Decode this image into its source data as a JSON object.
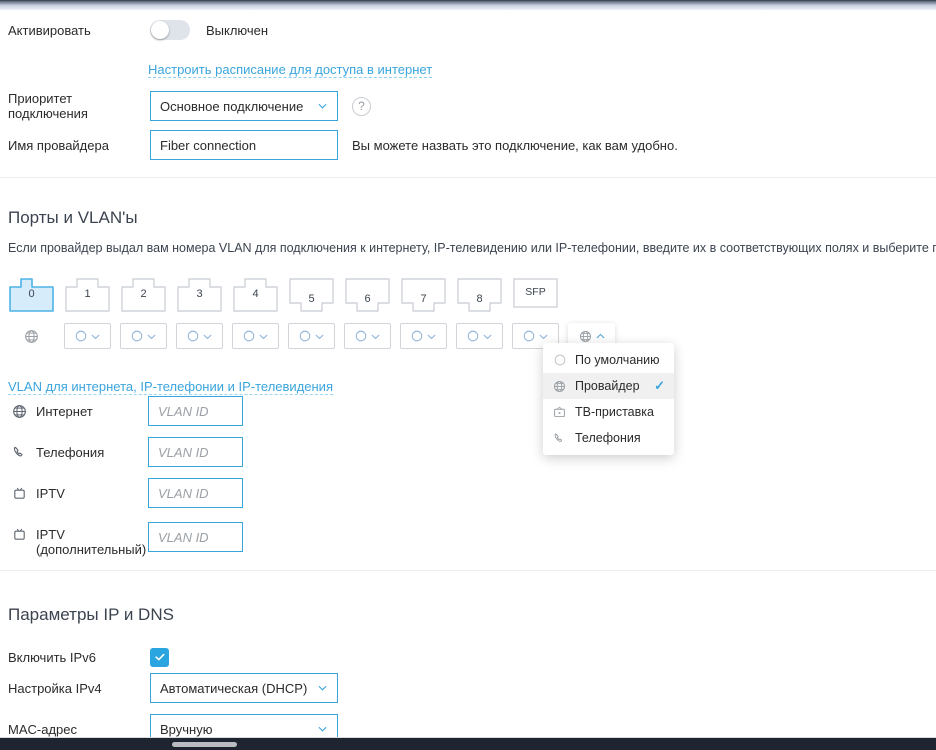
{
  "activate": {
    "label": "Активировать",
    "toggle_state_text": "Выключен",
    "toggle_on": false
  },
  "schedule_link": "Настроить расписание для доступа в интернет",
  "priority": {
    "label_line1": "Приоритет",
    "label_line2": "подключения",
    "value": "Основное подключение",
    "help_glyph": "?"
  },
  "provider_name": {
    "label": "Имя провайдера",
    "value": "Fiber connection",
    "hint": "Вы можете назвать это подключение, как вам удобно."
  },
  "ports_section": {
    "title": "Порты и VLAN'ы",
    "description": "Если провайдер выдал вам номера VLAN для подключения к интернету, IP-телевидению или IP-телефонии, введите их в соответствующих полях и выберите порты для п",
    "ports": [
      {
        "label": "0",
        "type": "rj45-up",
        "selected": true
      },
      {
        "label": "1",
        "type": "rj45-up",
        "selected": false
      },
      {
        "label": "2",
        "type": "rj45-up",
        "selected": false
      },
      {
        "label": "3",
        "type": "rj45-up",
        "selected": false
      },
      {
        "label": "4",
        "type": "rj45-up",
        "selected": false
      },
      {
        "label": "5",
        "type": "rj45-down",
        "selected": false
      },
      {
        "label": "6",
        "type": "rj45-down",
        "selected": false
      },
      {
        "label": "7",
        "type": "rj45-down",
        "selected": false
      },
      {
        "label": "8",
        "type": "rj45-down",
        "selected": false
      },
      {
        "label": "SFP",
        "type": "sfp",
        "selected": false
      }
    ],
    "row_lead_icon": "globe-icon",
    "port_dropdowns": [
      {
        "icon": "circle-icon",
        "open": false
      },
      {
        "icon": "circle-icon",
        "open": false
      },
      {
        "icon": "circle-icon",
        "open": false
      },
      {
        "icon": "circle-icon",
        "open": false
      },
      {
        "icon": "circle-icon",
        "open": false
      },
      {
        "icon": "circle-icon",
        "open": false
      },
      {
        "icon": "circle-icon",
        "open": false
      },
      {
        "icon": "circle-icon",
        "open": false
      },
      {
        "icon": "globe-icon",
        "open": true
      }
    ],
    "open_menu": {
      "items": [
        {
          "icon": "circle-icon",
          "label": "По умолчанию",
          "checked": false,
          "selected": false
        },
        {
          "icon": "globe-icon",
          "label": "Провайдер",
          "checked": true,
          "selected": true
        },
        {
          "icon": "tv-icon",
          "label": "ТВ-приставка",
          "checked": false,
          "selected": false
        },
        {
          "icon": "phone-icon",
          "label": "Телефония",
          "checked": false,
          "selected": false
        }
      ],
      "check_glyph": "✓"
    }
  },
  "vlan_section": {
    "link": "VLAN для интернета, IP-телефонии и IP-телевидения",
    "rows": [
      {
        "icon": "globe-icon",
        "name": "Интернет",
        "name2": "",
        "placeholder": "VLAN ID",
        "value": ""
      },
      {
        "icon": "phone-icon",
        "name": "Телефония",
        "name2": "",
        "placeholder": "VLAN ID",
        "value": ""
      },
      {
        "icon": "tv-icon",
        "name": "IPTV",
        "name2": "",
        "placeholder": "VLAN ID",
        "value": ""
      },
      {
        "icon": "tv-icon",
        "name": "IPTV",
        "name2": "(дополнительный)",
        "placeholder": "VLAN ID",
        "value": ""
      }
    ]
  },
  "ip_dns_section": {
    "title": "Параметры IP и DNS",
    "ipv6": {
      "label": "Включить IPv6",
      "checked": true,
      "check_glyph": "✓"
    },
    "ipv4": {
      "label": "Настройка IPv4",
      "value": "Автоматическая (DHCP)"
    },
    "mac": {
      "label": "MAC-адрес",
      "value": "Вручную"
    }
  },
  "colors": {
    "accent": "#3aa5dd",
    "checkbox": "#2aa5e0",
    "port_selected_fill": "#d6ecfa",
    "port_selected_border": "#4cb3e5",
    "text": "#2b2b2b",
    "muted": "#9aa0a6"
  }
}
